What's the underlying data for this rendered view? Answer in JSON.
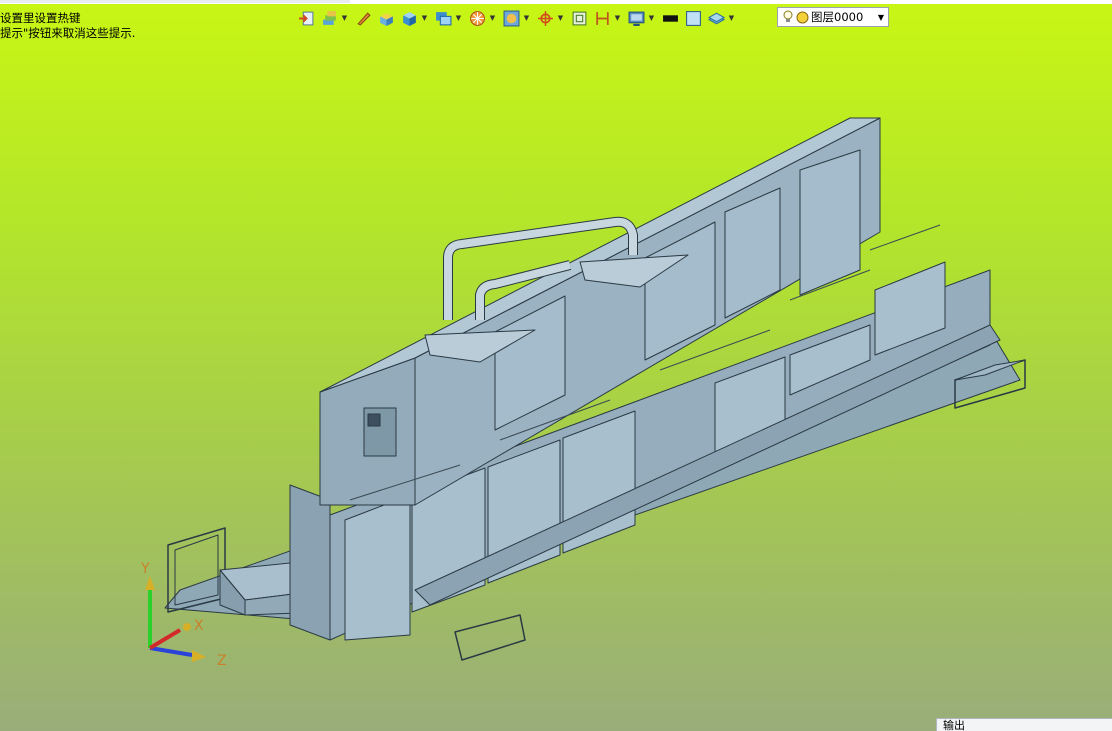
{
  "hints": {
    "line1": "设置里设置热键",
    "line2": "提示\"按钮来取消这些提示."
  },
  "toolbar": {
    "items": [
      {
        "name": "exit-icon",
        "dropdown": false
      },
      {
        "name": "layers-icon",
        "dropdown": true
      },
      {
        "name": "pen-icon",
        "dropdown": false
      },
      {
        "name": "box-icon",
        "dropdown": false
      },
      {
        "name": "cube-icon",
        "dropdown": true
      },
      {
        "name": "view-icon",
        "dropdown": true
      },
      {
        "name": "render-icon",
        "dropdown": true
      },
      {
        "name": "shade-icon",
        "dropdown": true
      },
      {
        "name": "snap-icon",
        "dropdown": true
      },
      {
        "name": "frame-icon",
        "dropdown": false
      },
      {
        "name": "dimension-icon",
        "dropdown": true
      },
      {
        "name": "display-icon",
        "dropdown": true
      },
      {
        "name": "line-color-icon",
        "dropdown": false
      },
      {
        "name": "fill-color-icon",
        "dropdown": false
      },
      {
        "name": "plane-icon",
        "dropdown": true
      }
    ]
  },
  "layer": {
    "name": "图层0000"
  },
  "axes": {
    "x": "X",
    "y": "Y",
    "z": "Z"
  },
  "output_panel": {
    "title": "输出"
  },
  "colors": {
    "model_fill": "#9fb7c6",
    "model_line": "#2a3a44",
    "background_top": "#c8f614",
    "background_bottom": "#99ad7a"
  }
}
